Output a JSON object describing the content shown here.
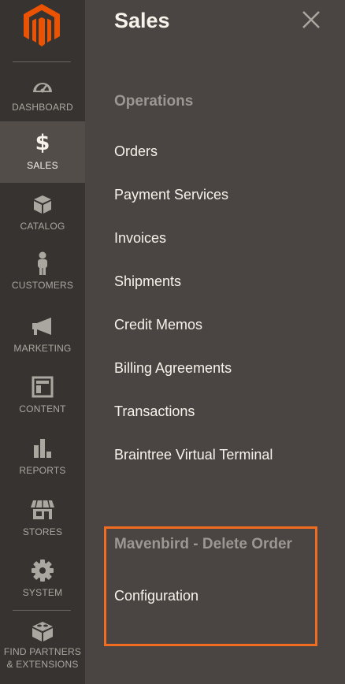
{
  "brand": {
    "logo": "magento-logo",
    "accent": "#eb5202"
  },
  "colors": {
    "rail_bg": "#373330",
    "panel_bg": "#4a4542",
    "active_bg": "#524d49",
    "highlight": "#ef6c21"
  },
  "nav": {
    "items": [
      {
        "label": "DASHBOARD",
        "icon": "dashboard-gauge-icon"
      },
      {
        "label": "SALES",
        "icon": "dollar-icon",
        "active": true
      },
      {
        "label": "CATALOG",
        "icon": "box-icon"
      },
      {
        "label": "CUSTOMERS",
        "icon": "person-icon"
      },
      {
        "label": "MARKETING",
        "icon": "megaphone-icon"
      },
      {
        "label": "CONTENT",
        "icon": "layout-icon"
      },
      {
        "label": "REPORTS",
        "icon": "bar-chart-icon"
      },
      {
        "label": "STORES",
        "icon": "storefront-icon"
      },
      {
        "label": "SYSTEM",
        "icon": "gear-icon"
      },
      {
        "label": "FIND PARTNERS & EXTENSIONS",
        "icon": "blocks-icon"
      }
    ]
  },
  "panel": {
    "title": "Sales",
    "close_icon": "close-icon",
    "operations": {
      "title": "Operations",
      "links": [
        "Orders",
        "Payment Services",
        "Invoices",
        "Shipments",
        "Credit Memos",
        "Billing Agreements",
        "Transactions",
        "Braintree Virtual Terminal"
      ]
    },
    "extension": {
      "title": "Mavenbird - Delete Order",
      "links": [
        "Configuration"
      ]
    }
  }
}
